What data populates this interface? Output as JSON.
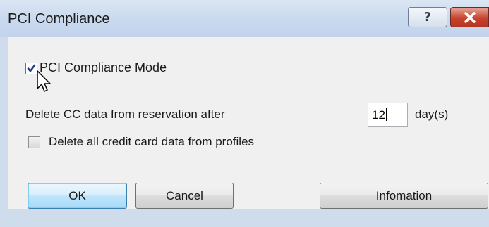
{
  "window": {
    "title": "PCI Compliance"
  },
  "title_buttons": {
    "help": "?",
    "help_icon": "question-mark-icon",
    "close_icon": "close-x-icon"
  },
  "pci_mode": {
    "label": "PCI Compliance Mode",
    "checked": true
  },
  "delete_cc": {
    "label": "Delete CC data from reservation after",
    "value": "12",
    "unit": "day(s)"
  },
  "delete_all": {
    "label": "Delete all credit card data from profiles",
    "checked": false
  },
  "buttons": {
    "ok": "OK",
    "cancel": "Cancel",
    "information": "Infomation"
  },
  "colors": {
    "accent": "#3c7fb1",
    "close": "#c8422e",
    "frame": "#cfdcec"
  }
}
